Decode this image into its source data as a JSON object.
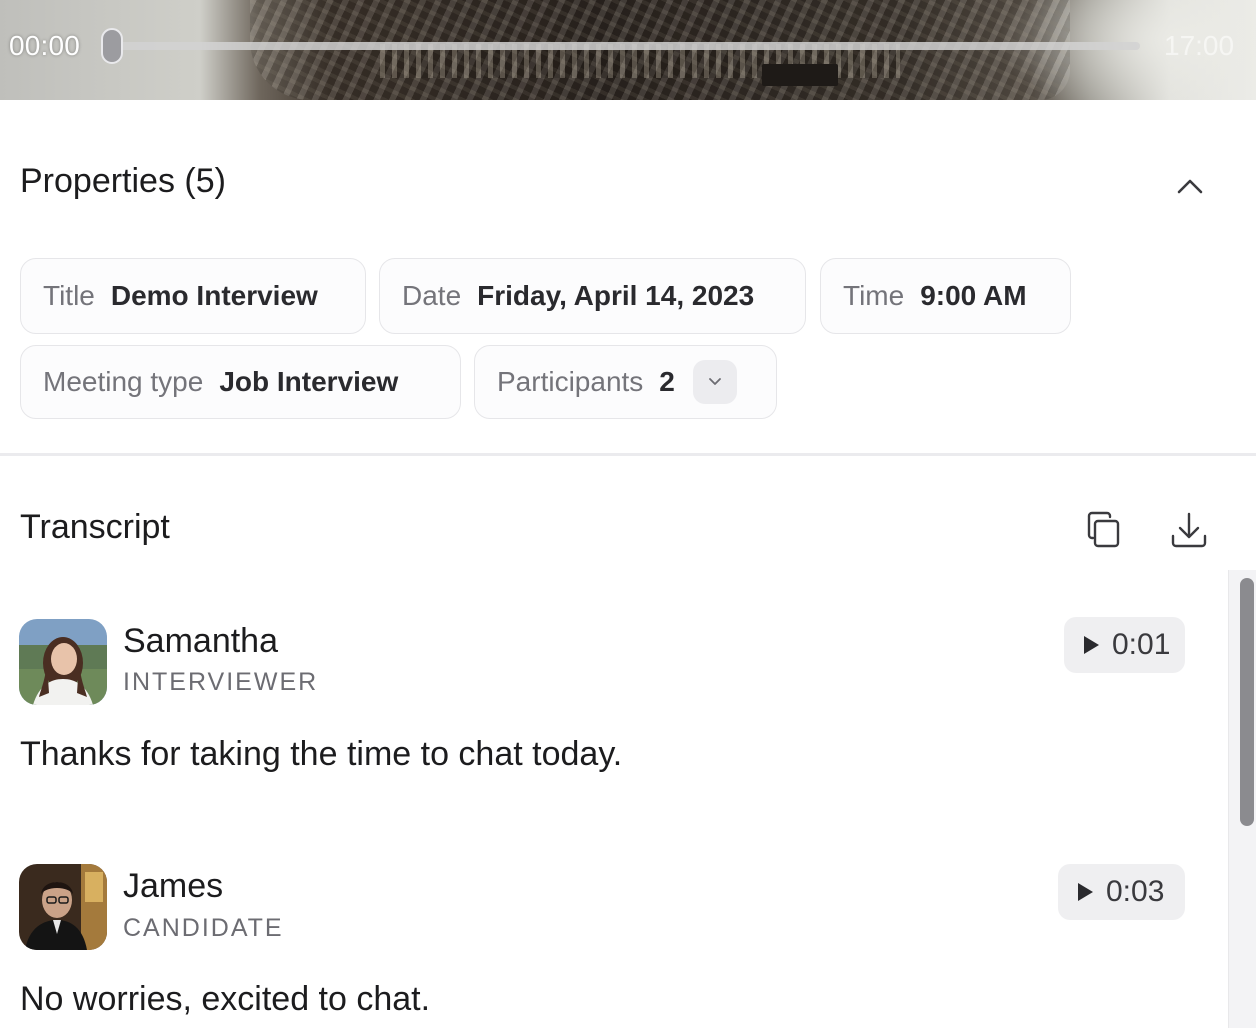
{
  "player": {
    "current_time": "00:00",
    "total_time": "17:00",
    "progress": 0
  },
  "properties": {
    "heading": "Properties (5)",
    "collapse_icon": "chevron-up-icon",
    "items": [
      {
        "key": "Title",
        "value": "Demo Interview"
      },
      {
        "key": "Date",
        "value": "Friday, April 14, 2023"
      },
      {
        "key": "Time",
        "value": "9:00 AM"
      },
      {
        "key": "Meeting type",
        "value": "Job Interview"
      },
      {
        "key": "Participants",
        "value": "2",
        "icon": "chevron-down-icon"
      }
    ]
  },
  "transcript": {
    "heading": "Transcript",
    "actions": [
      {
        "icon": "copy-icon"
      },
      {
        "icon": "download-icon"
      }
    ],
    "entries": [
      {
        "speaker": "Samantha",
        "role": "INTERVIEWER",
        "timestamp": "0:01",
        "text": "Thanks for taking the time to chat today.",
        "play_icon": "play-icon"
      },
      {
        "speaker": "James",
        "role": "CANDIDATE",
        "timestamp": "0:03",
        "text": "No worries, excited to chat.",
        "play_icon": "play-icon"
      }
    ]
  },
  "colors": {
    "text_primary": "#1c1c1e",
    "text_secondary": "#74747a",
    "chip_border": "#e6e6e9",
    "button_bg": "#efeff1"
  }
}
